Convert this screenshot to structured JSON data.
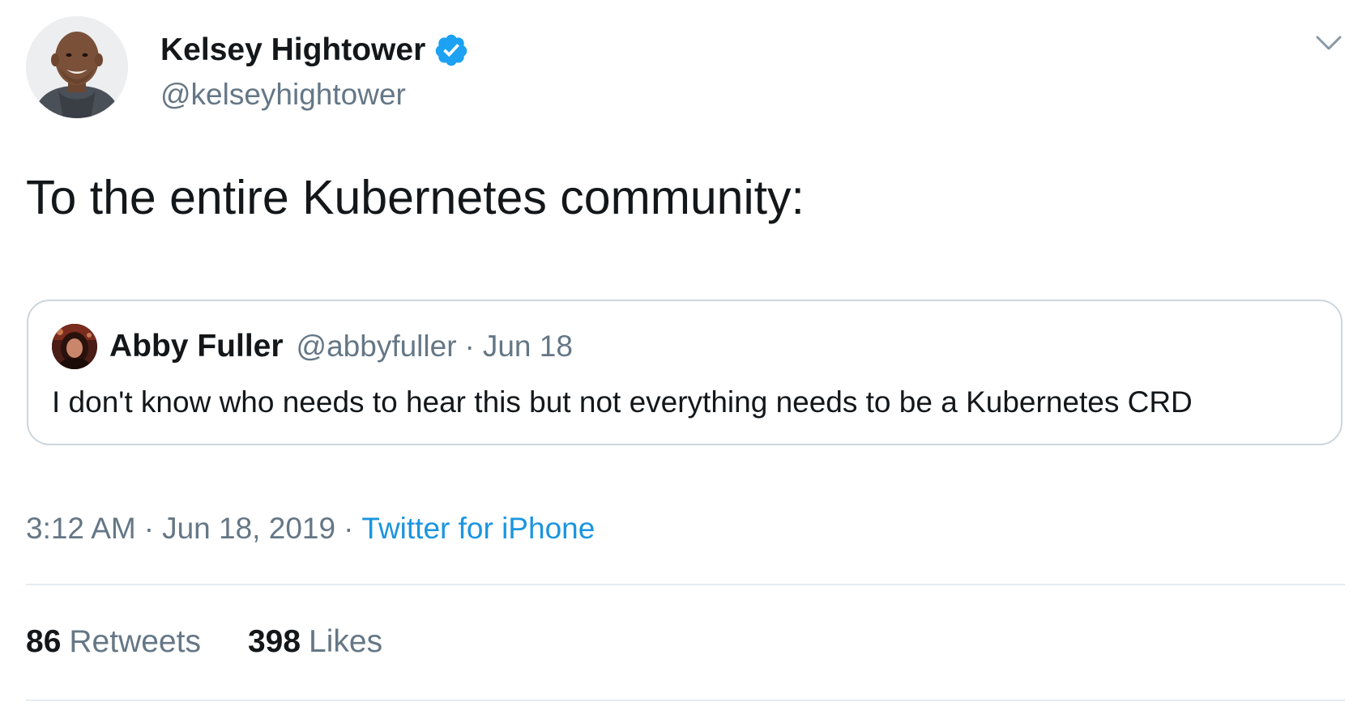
{
  "tweet": {
    "author": {
      "name": "Kelsey Hightower",
      "handle": "@kelseyhightower",
      "verified": true,
      "avatar_icon": "profile-photo"
    },
    "text": "To the entire Kubernetes community:",
    "menu_icon": "chevron-down-icon",
    "quoted": {
      "name": "Abby Fuller",
      "handle": "@abbyfuller",
      "separator": "·",
      "date": "Jun 18",
      "text": "I don't know who needs to hear this but not everything needs to be a Kubernetes CRD",
      "avatar_icon": "profile-photo"
    },
    "meta": {
      "time": "3:12 AM",
      "separator": "·",
      "date": "Jun 18, 2019",
      "source": "Twitter for iPhone"
    },
    "stats": {
      "retweets_count": "86",
      "retweets_label": "Retweets",
      "likes_count": "398",
      "likes_label": "Likes"
    }
  },
  "colors": {
    "text_primary": "#14171a",
    "text_secondary": "#657786",
    "link": "#1b95e0",
    "verified": "#1da1f2",
    "border": "#ccd6dd",
    "divider": "#e6ecf0"
  }
}
